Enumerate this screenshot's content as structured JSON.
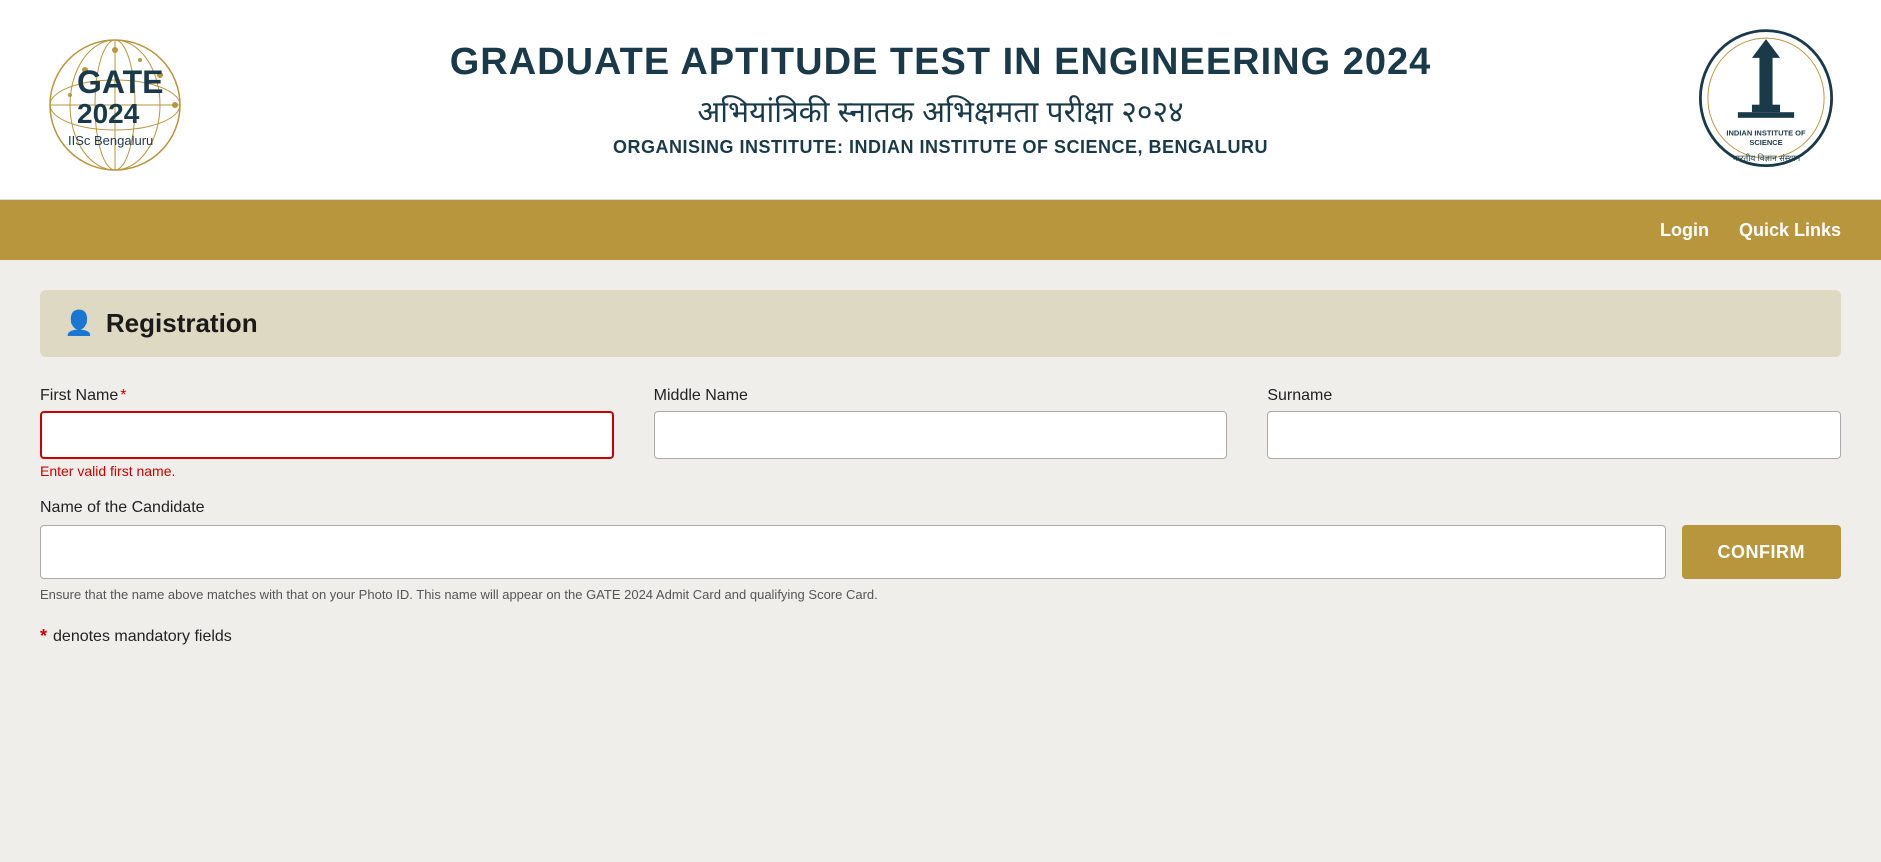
{
  "header": {
    "title_en": "GRADUATE APTITUDE TEST IN ENGINEERING 2024",
    "title_hi": "अभियांत्रिकी स्नातक अभिक्षमता परीक्षा २०२४",
    "subtitle": "ORGANISING INSTITUTE: INDIAN INSTITUTE OF SCIENCE, BENGALURU",
    "gate_label": "GATE",
    "gate_year": "2024",
    "gate_institute": "IISc Bengaluru"
  },
  "navbar": {
    "login_label": "Login",
    "quick_links_label": "Quick Links"
  },
  "registration": {
    "section_title": "Registration",
    "form": {
      "first_name_label": "First Name",
      "first_name_required": true,
      "first_name_error": "Enter valid first name.",
      "middle_name_label": "Middle Name",
      "surname_label": "Surname",
      "candidate_name_label": "Name of the Candidate",
      "candidate_name_hint": "Ensure that the name above matches with that on your Photo ID. This name will appear on the GATE 2024 Admit Card and qualifying Score Card.",
      "confirm_button_label": "CONFIRM",
      "mandatory_star": "*",
      "mandatory_text": "denotes mandatory fields"
    }
  },
  "colors": {
    "gold": "#b8963e",
    "dark_teal": "#1a3a4a",
    "error_red": "#cc0000",
    "section_bg": "#ddd9c3",
    "page_bg": "#f0eeea"
  }
}
